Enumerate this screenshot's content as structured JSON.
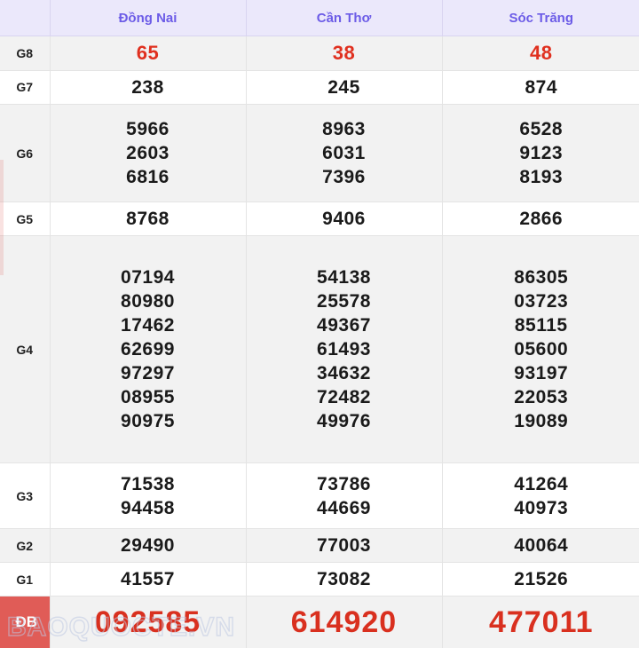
{
  "table": {
    "corner_label": "",
    "columns": [
      {
        "name": "Đồng Nai"
      },
      {
        "name": "Cần Thơ"
      },
      {
        "name": "Sóc Trăng"
      }
    ],
    "rows": [
      {
        "label": "G8",
        "style": "alt",
        "highlight": "red",
        "cells": [
          [
            "65"
          ],
          [
            "38"
          ],
          [
            "48"
          ]
        ]
      },
      {
        "label": "G7",
        "style": "plain",
        "highlight": "normal",
        "cells": [
          [
            "238"
          ],
          [
            "245"
          ],
          [
            "874"
          ]
        ]
      },
      {
        "label": "G6",
        "style": "alt",
        "highlight": "normal",
        "cells": [
          [
            "5966",
            "2603",
            "6816"
          ],
          [
            "8963",
            "6031",
            "7396"
          ],
          [
            "6528",
            "9123",
            "8193"
          ]
        ]
      },
      {
        "label": "G5",
        "style": "plain",
        "highlight": "normal",
        "cells": [
          [
            "8768"
          ],
          [
            "9406"
          ],
          [
            "2866"
          ]
        ]
      },
      {
        "label": "G4",
        "style": "alt",
        "highlight": "normal",
        "cells": [
          [
            "07194",
            "80980",
            "17462",
            "62699",
            "97297",
            "08955",
            "90975"
          ],
          [
            "54138",
            "25578",
            "49367",
            "61493",
            "34632",
            "72482",
            "49976"
          ],
          [
            "86305",
            "03723",
            "85115",
            "05600",
            "93197",
            "22053",
            "19089"
          ]
        ]
      },
      {
        "label": "G3",
        "style": "plain",
        "highlight": "normal",
        "cells": [
          [
            "71538",
            "94458"
          ],
          [
            "73786",
            "44669"
          ],
          [
            "41264",
            "40973"
          ]
        ]
      },
      {
        "label": "G2",
        "style": "alt",
        "highlight": "normal",
        "cells": [
          [
            "29490"
          ],
          [
            "77003"
          ],
          [
            "40064"
          ]
        ]
      },
      {
        "label": "G1",
        "style": "plain",
        "highlight": "normal",
        "cells": [
          [
            "41557"
          ],
          [
            "73082"
          ],
          [
            "21526"
          ]
        ]
      }
    ],
    "special_row": {
      "label": "ĐB",
      "cells": [
        "092585",
        "614920",
        "477011"
      ]
    }
  },
  "watermark": {
    "text": "BAOQUOCTE.VN"
  },
  "colors": {
    "header_bg": "#ebe8fb",
    "header_text": "#6c5ce7",
    "red": "#e0301f",
    "special_red": "#d9301f",
    "badge_bg": "#e05c57",
    "alt_row": "#f2f2f2"
  }
}
